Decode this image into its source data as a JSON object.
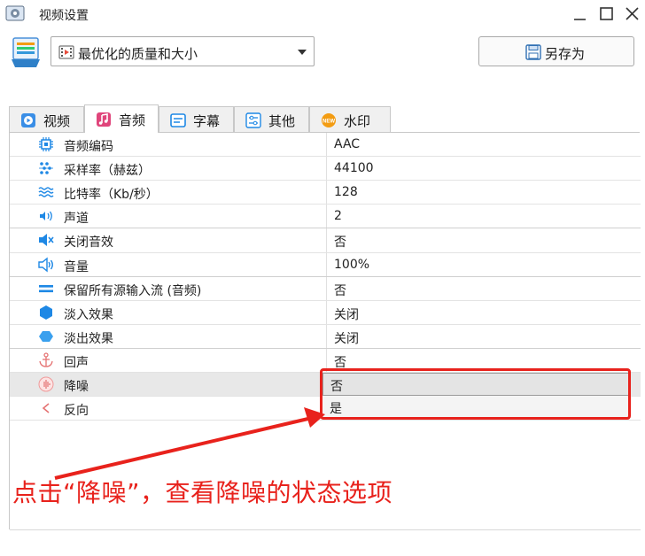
{
  "window": {
    "title": "视频设置"
  },
  "preset": {
    "selected": "最优化的质量和大小"
  },
  "toolbar": {
    "save_as_label": "另存为"
  },
  "tabs": [
    {
      "label": "视频",
      "icon": "video-play-icon",
      "active": false
    },
    {
      "label": "音频",
      "icon": "music-note-icon",
      "active": true
    },
    {
      "label": "字幕",
      "icon": "subtitle-icon",
      "active": false
    },
    {
      "label": "其他",
      "icon": "sliders-icon",
      "active": false
    },
    {
      "label": "水印",
      "icon": "new-badge-icon",
      "active": false
    }
  ],
  "properties": [
    {
      "label": "音频编码",
      "value": "AAC",
      "icon": "chip-icon"
    },
    {
      "label": "采样率（赫兹）",
      "value": "44100",
      "icon": "sample-rate-icon"
    },
    {
      "label": "比特率（Kb/秒）",
      "value": "128",
      "icon": "bitrate-wave-icon"
    },
    {
      "label": "声道",
      "value": "2",
      "icon": "channel-icon"
    },
    {
      "label": "关闭音效",
      "value": "否",
      "icon": "mute-speaker-icon"
    },
    {
      "label": "音量",
      "value": "100%",
      "icon": "volume-icon"
    },
    {
      "label": "保留所有源输入流 (音频)",
      "value": "否",
      "icon": "equals-icon"
    },
    {
      "label": "淡入效果",
      "value": "关闭",
      "icon": "hexagon-fill-icon"
    },
    {
      "label": "淡出效果",
      "value": "关闭",
      "icon": "hexagon-light-icon"
    },
    {
      "label": "回声",
      "value": "否",
      "icon": "echo-anchor-icon"
    },
    {
      "label": "降噪",
      "value": "",
      "icon": "noise-reduction-icon"
    },
    {
      "label": "反向",
      "value": "",
      "icon": "reverse-icon"
    }
  ],
  "denoise_options": [
    "否",
    "是"
  ],
  "annotation": {
    "caption": "点击“降噪”，查看降噪的状态选项",
    "color": "#e8221c"
  },
  "colors": {
    "accent_blue": "#1e88e5",
    "annotation_red": "#e8221c"
  }
}
